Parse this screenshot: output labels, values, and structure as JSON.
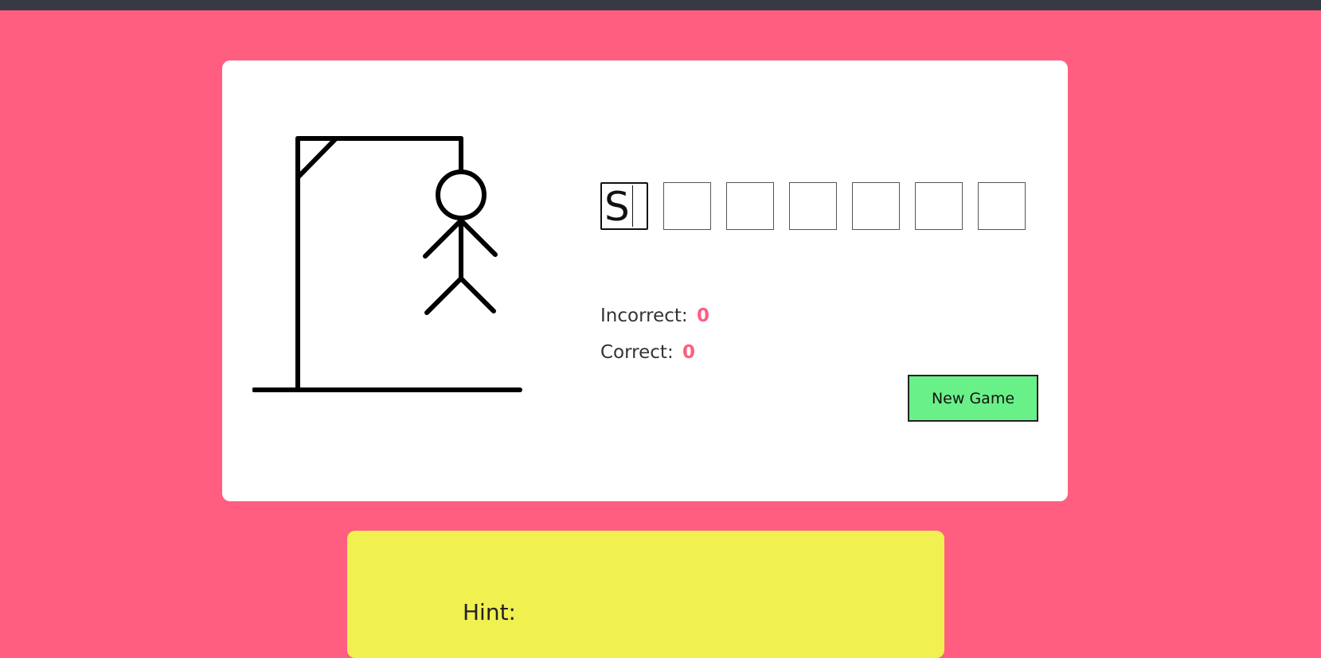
{
  "game": {
    "letters": [
      "S",
      "",
      "",
      "",
      "",
      "",
      ""
    ],
    "incorrect_label": "Incorrect:",
    "incorrect_count": "0",
    "correct_label": "Correct:",
    "correct_count": "0",
    "new_game_label": "New Game"
  },
  "hint": {
    "label": "Hint:"
  },
  "colors": {
    "background": "#ff5e81",
    "topbar": "#373a42",
    "card": "#ffffff",
    "button": "#6af088",
    "hint_card": "#f0f050",
    "accent_count": "#ff5e81"
  }
}
